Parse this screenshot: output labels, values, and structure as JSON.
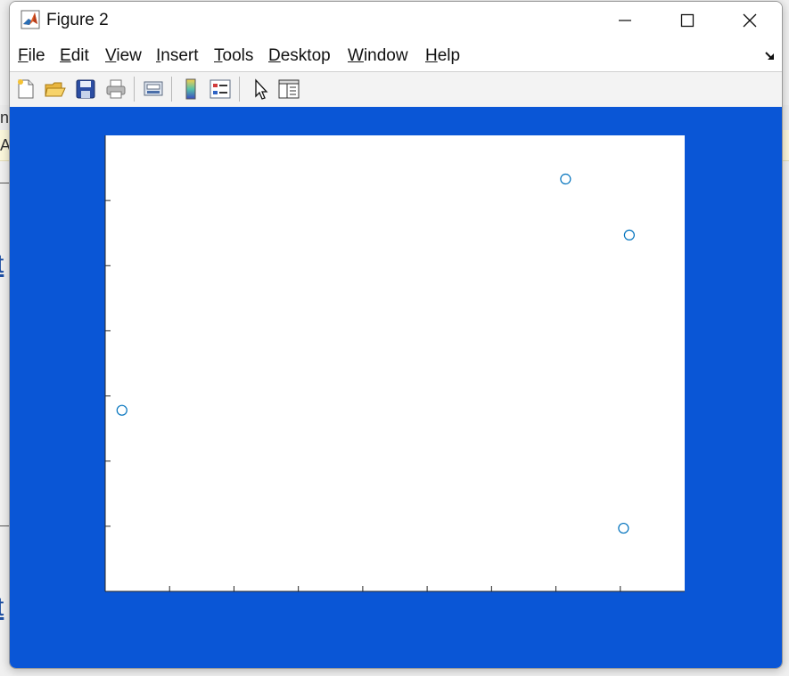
{
  "window": {
    "title": "Figure 2"
  },
  "menu": [
    {
      "label": "File",
      "accel": "F",
      "rest": "ile"
    },
    {
      "label": "Edit",
      "accel": "E",
      "rest": "dit"
    },
    {
      "label": "View",
      "accel": "V",
      "rest": "iew"
    },
    {
      "label": "Insert",
      "accel": "I",
      "rest": "nsert"
    },
    {
      "label": "Tools",
      "accel": "T",
      "rest": "ools"
    },
    {
      "label": "Desktop",
      "accel": "D",
      "rest": "esktop"
    },
    {
      "label": "Window",
      "accel": "W",
      "rest": "indow"
    },
    {
      "label": "Help",
      "accel": "H",
      "rest": "elp"
    }
  ],
  "toolbar": [
    {
      "icon": "new-figure-icon"
    },
    {
      "icon": "open-file-icon"
    },
    {
      "icon": "save-icon"
    },
    {
      "icon": "print-icon"
    },
    {
      "icon": "link-plot-icon"
    },
    {
      "icon": "insert-colorbar-icon"
    },
    {
      "icon": "insert-legend-icon"
    },
    {
      "icon": "edit-plot-arrow-icon"
    },
    {
      "icon": "property-inspector-icon"
    }
  ],
  "background": {
    "fragment_a": "n",
    "fragment_b": "A",
    "link_glyph": "t"
  },
  "colors": {
    "figure_bg": "#0a56d6",
    "marker": "#0072bd",
    "axes_bg": "#ffffff"
  },
  "chart_data": {
    "type": "scatter",
    "marker": "circle",
    "xlim": [
      0,
      9
    ],
    "ylim": [
      0,
      7
    ],
    "x_tick_count": 9,
    "y_tick_count": 7,
    "tick_labels_visible": false,
    "grid": false,
    "series": [
      {
        "x": [
          0.26,
          7.15,
          8.05,
          8.14
        ],
        "y": [
          2.78,
          6.33,
          0.97,
          5.47
        ]
      }
    ]
  }
}
